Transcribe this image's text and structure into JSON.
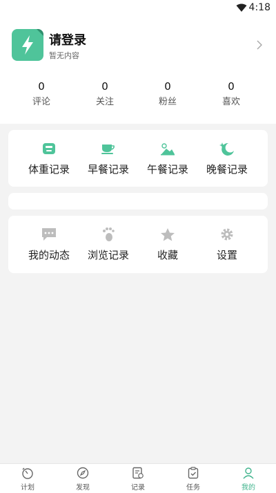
{
  "status": {
    "time": "4:18"
  },
  "profile": {
    "title": "请登录",
    "subtitle": "暂无内容"
  },
  "stats": [
    {
      "value": "0",
      "label": "评论"
    },
    {
      "value": "0",
      "label": "关注"
    },
    {
      "value": "0",
      "label": "粉丝"
    },
    {
      "value": "0",
      "label": "喜欢"
    }
  ],
  "records": [
    {
      "label": "体重记录",
      "icon": "scale-icon"
    },
    {
      "label": "早餐记录",
      "icon": "coffee-cup-icon"
    },
    {
      "label": "午餐记录",
      "icon": "sun-meal-icon"
    },
    {
      "label": "晚餐记录",
      "icon": "moon-icon"
    }
  ],
  "menu": [
    {
      "label": "我的动态",
      "icon": "chat-bubble-icon"
    },
    {
      "label": "浏览记录",
      "icon": "footprint-icon"
    },
    {
      "label": "收藏",
      "icon": "star-icon"
    },
    {
      "label": "设置",
      "icon": "gear-icon"
    }
  ],
  "tabs": [
    {
      "label": "计划",
      "icon": "timer-icon"
    },
    {
      "label": "发现",
      "icon": "compass-icon"
    },
    {
      "label": "记录",
      "icon": "record-doc-icon"
    },
    {
      "label": "任务",
      "icon": "clipboard-check-icon"
    },
    {
      "label": "我的",
      "icon": "person-icon",
      "active": true
    }
  ],
  "colors": {
    "accent": "#3fb38c",
    "icon_gray": "#bdbdbd"
  }
}
